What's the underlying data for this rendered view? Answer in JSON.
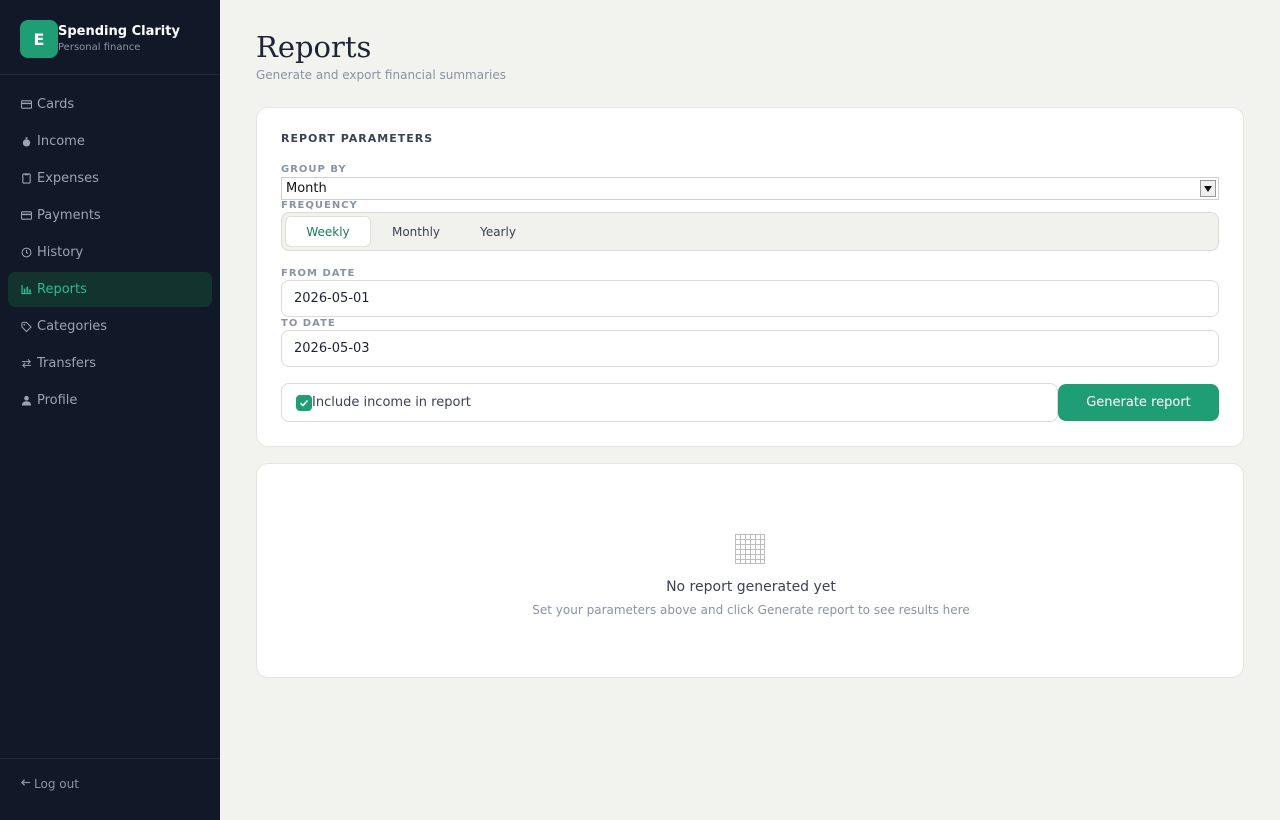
{
  "brand": {
    "logo_letter": "E",
    "name": "Spending Clarity",
    "subtitle": "Personal finance"
  },
  "sidebar": {
    "items": [
      {
        "label": "Cards",
        "icon": "card-icon",
        "active": false
      },
      {
        "label": "Income",
        "icon": "money-bag-icon",
        "active": false
      },
      {
        "label": "Expenses",
        "icon": "receipt-icon",
        "active": false
      },
      {
        "label": "Payments",
        "icon": "card-icon",
        "active": false
      },
      {
        "label": "History",
        "icon": "clock-icon",
        "active": false
      },
      {
        "label": "Reports",
        "icon": "bar-chart-icon",
        "active": true
      },
      {
        "label": "Categories",
        "icon": "tag-icon",
        "active": false
      },
      {
        "label": "Transfers",
        "icon": "swap-icon",
        "active": false
      },
      {
        "label": "Profile",
        "icon": "person-icon",
        "active": false
      }
    ],
    "logout_label": "Log out"
  },
  "page": {
    "title": "Reports",
    "subtitle": "Generate and export financial summaries"
  },
  "params": {
    "section_title": "REPORT PARAMETERS",
    "group_by_label": "GROUP BY",
    "group_by_value": "Month",
    "frequency_label": "FREQUENCY",
    "frequency_options": [
      "Weekly",
      "Monthly",
      "Yearly"
    ],
    "frequency_selected": "Weekly",
    "from_date_label": "FROM DATE",
    "from_date_value": "2026-05-01",
    "to_date_label": "TO DATE",
    "to_date_value": "2026-05-03",
    "include_income_label": "Include income in report",
    "include_income_checked": true,
    "generate_label": "Generate report"
  },
  "result": {
    "empty_title": "No report generated yet",
    "empty_subtitle": "Set your parameters above and click Generate report to see results here"
  },
  "colors": {
    "accent": "#1f9d74",
    "sidebar_bg": "#111827",
    "page_bg": "#f2f2ee"
  }
}
